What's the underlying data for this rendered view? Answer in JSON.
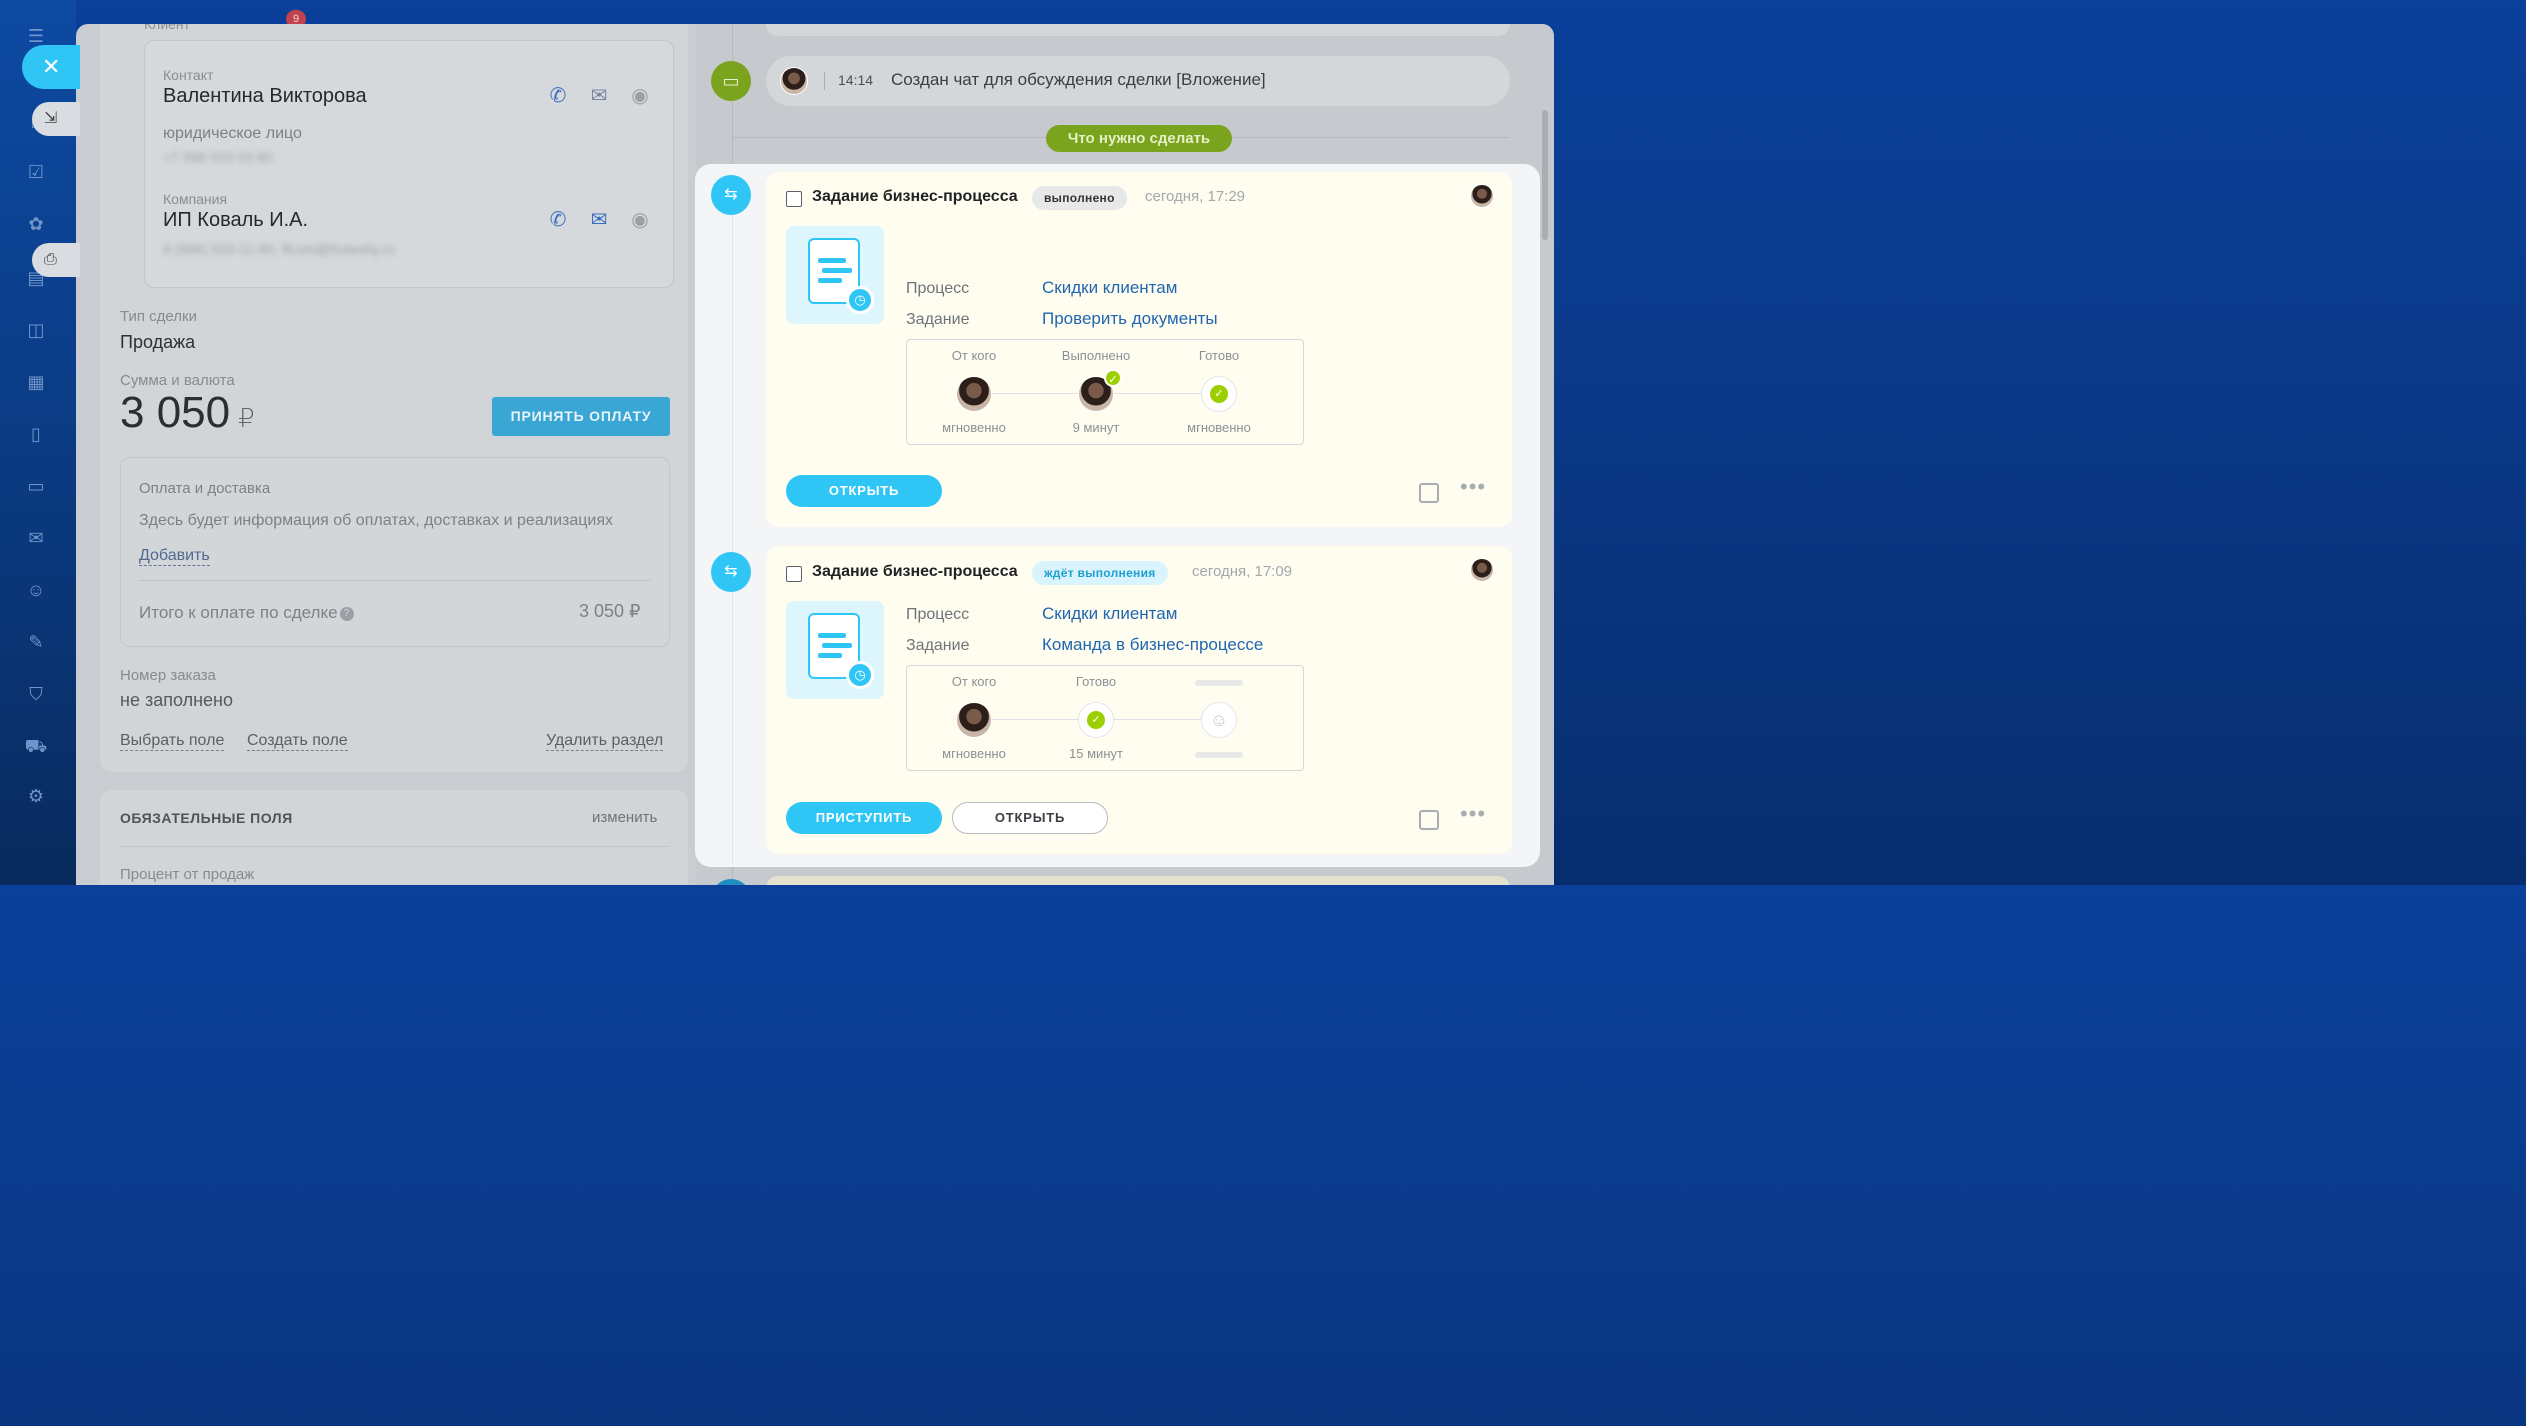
{
  "nav": {
    "badge_count": "9",
    "close_icon": "close-icon",
    "icons": [
      "menu-icon",
      "home-icon",
      "tasks-icon",
      "feed-icon",
      "document-icon",
      "chat-icon",
      "calendar-icon",
      "file-icon",
      "card-icon",
      "mail-icon",
      "contacts-icon",
      "pen-icon",
      "funnel-icon",
      "truck-icon",
      "settings-icon"
    ]
  },
  "left": {
    "client_label": "Клиент",
    "contact": {
      "label": "Контакт",
      "name": "Валентина Викторова",
      "type": "юридическое лицо",
      "phone": "+7 996 533 03 60"
    },
    "company": {
      "label": "Компания",
      "name": "ИП Коваль И.А.",
      "details": "8 (996) 533-11-80, ffcom@fruteshy.ru"
    },
    "deal_type": {
      "label": "Тип сделки",
      "value": "Продажа"
    },
    "amount": {
      "label": "Сумма и валюта",
      "value": "3 050",
      "currency": "₽",
      "pay_button": "ПРИНЯТЬ ОПЛАТУ"
    },
    "payment": {
      "title": "Оплата и доставка",
      "info": "Здесь будет информация об оплатах, доставках и реализациях",
      "add_link": "Добавить",
      "total_label": "Итого к оплате по сделке",
      "total_value": "3 050 ₽"
    },
    "order": {
      "label": "Номер заказа",
      "value": "не заполнено"
    },
    "actions": {
      "select_field": "Выбрать поле",
      "create_field": "Создать поле",
      "delete_section": "Удалить раздел"
    },
    "required": {
      "title": "ОБЯЗАТЕЛЬНЫЕ ПОЛЯ",
      "edit": "изменить",
      "first_field": "Процент от продаж"
    }
  },
  "timeline": {
    "chat_entry": {
      "time": "14:14",
      "text": "Создан чат для обсуждения сделки [Вложение]"
    },
    "todo_label": "Что нужно сделать",
    "cards": [
      {
        "title": "Задание бизнес-процесса",
        "status": "выполнено",
        "time": "сегодня, 17:29",
        "process_label": "Процесс",
        "process_value": "Скидки клиентам",
        "task_label": "Задание",
        "task_value": "Проверить документы",
        "steps": [
          {
            "head": "От кого",
            "foot": "мгновенно"
          },
          {
            "head": "Выполнено",
            "foot": "9 минут"
          },
          {
            "head": "Готово",
            "foot": "мгновенно"
          }
        ],
        "buttons": {
          "open": "ОТКРЫТЬ"
        }
      },
      {
        "title": "Задание бизнес-процесса",
        "status": "ждёт выполнения",
        "time": "сегодня, 17:09",
        "process_label": "Процесс",
        "process_value": "Скидки клиентам",
        "task_label": "Задание",
        "task_value": "Команда в бизнес-процессе",
        "steps": [
          {
            "head": "От кого",
            "foot": "мгновенно"
          },
          {
            "head": "Готово",
            "foot": "15 минут"
          }
        ],
        "buttons": {
          "start": "ПРИСТУПИТЬ",
          "open": "ОТКРЫТЬ"
        }
      }
    ]
  },
  "colors": {
    "accent": "#2fc6f6",
    "green": "#9dcf00",
    "link": "#2067b0",
    "card_bg": "#fffdf0"
  }
}
